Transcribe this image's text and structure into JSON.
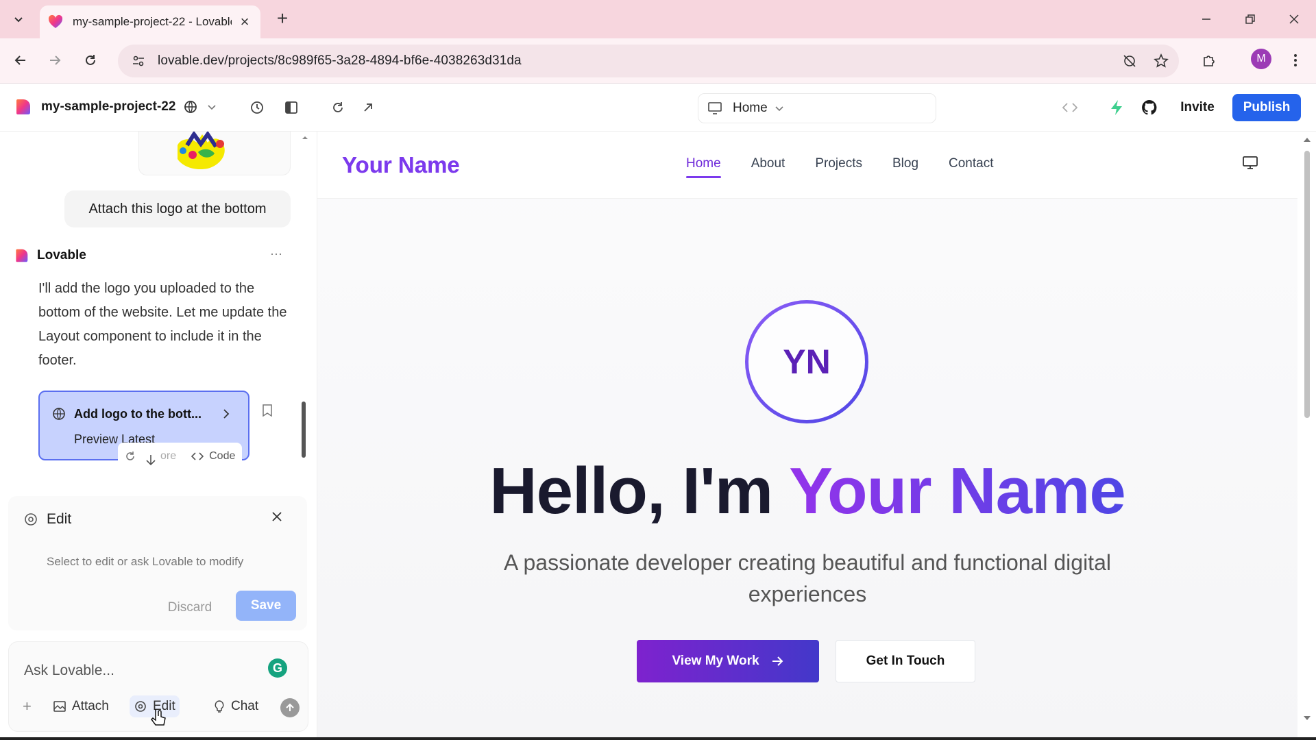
{
  "browser": {
    "tab_title": "my-sample-project-22 - Lovable",
    "tab_close": "×",
    "new_tab": "+",
    "url": "lovable.dev/projects/8c989f65-3a28-4894-bf6e-4038263d31da",
    "profile_initial": "M"
  },
  "toolbar": {
    "project_name": "my-sample-project-22",
    "route": "Home",
    "invite_label": "Invite",
    "publish_label": "Publish"
  },
  "chat": {
    "user_message": "Attach this logo at the bottom",
    "assistant_name": "Lovable",
    "more_label": "···",
    "assistant_message": "I'll add the logo you uploaded to the bottom of the website. Let me update the Layout component to include it in the footer.",
    "version_card": {
      "title": "Add logo to the bott...",
      "subtitle": "Preview Latest"
    },
    "card_actions": {
      "restore": "ore",
      "code": "Code"
    }
  },
  "edit_panel": {
    "title": "Edit",
    "hint": "Select to edit or ask Lovable to modify",
    "discard_label": "Discard",
    "save_label": "Save"
  },
  "composer": {
    "placeholder": "Ask Lovable...",
    "grammarly": "G",
    "add": "+",
    "attach_label": "Attach",
    "edit_label": "Edit",
    "chat_label": "Chat"
  },
  "preview": {
    "brand": "Your Name",
    "nav": [
      "Home",
      "About",
      "Projects",
      "Blog",
      "Contact"
    ],
    "active_nav": "Home",
    "initials": "YN",
    "hero_prefix": "Hello, I'm ",
    "hero_name": "Your Name",
    "tagline": "A passionate developer creating beautiful and functional digital experiences",
    "primary_cta": "View My Work",
    "secondary_cta": "Get In Touch"
  },
  "colors": {
    "tabstrip": "#f7d6de",
    "accent_purple": "#7c3aed",
    "publish_blue": "#2563eb",
    "version_card": "#c7d2fe"
  }
}
